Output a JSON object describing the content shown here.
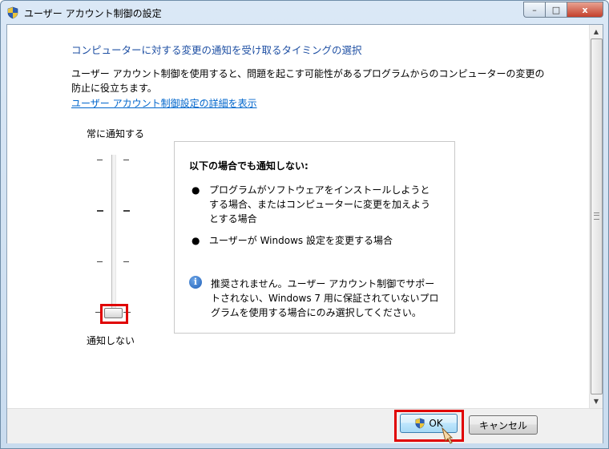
{
  "window": {
    "title": "ユーザー アカウント制御の設定",
    "buttons": {
      "minimize": "–",
      "maximize": "□",
      "close": "x"
    }
  },
  "content": {
    "heading": "コンピューターに対する変更の通知を受け取るタイミングの選択",
    "description": "ユーザー アカウント制御を使用すると、問題を起こす可能性があるプログラムからのコンピューターの変更の防止に役立ちます。",
    "link": "ユーザー アカウント制御設定の詳細を表示"
  },
  "slider": {
    "top_label": "常に通知する",
    "bottom_label": "通知しない",
    "levels": 4,
    "selected_level": 1
  },
  "panel": {
    "title": "以下の場合でも通知しない:",
    "bullets": [
      "プログラムがソフトウェアをインストールしようとする場合、またはコンピューターに変更を加えようとする場合",
      "ユーザーが Windows 設定を変更する場合"
    ],
    "info": "推奨されません。ユーザー アカウント制御でサポートされない、Windows 7 用に保証されていないプログラムを使用する場合にのみ選択してください。"
  },
  "footer": {
    "ok_label": "OK",
    "cancel_label": "キャンセル"
  },
  "icons": {
    "title": "uac-shield-icon",
    "info": "info-icon",
    "ok": "uac-shield-icon",
    "cursor": "hand-pointer-icon"
  }
}
